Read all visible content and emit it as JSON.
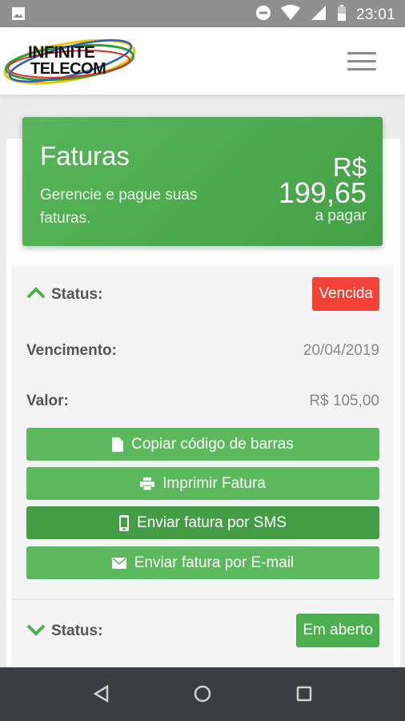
{
  "status_bar": {
    "time": "23:01",
    "icons": [
      "image-icon",
      "do-not-disturb-icon",
      "wifi-icon",
      "signal-icon",
      "battery-icon"
    ]
  },
  "header": {
    "logo_line1": "INFINITE",
    "logo_line2": "TELECOM",
    "menu_icon": "hamburger-icon"
  },
  "hero": {
    "title": "Faturas",
    "subtitle": "Gerencie e pague suas faturas.",
    "amount_currency": "R$",
    "amount_value": "199,65",
    "amount_label": "a pagar"
  },
  "invoice": {
    "status_label": "Status:",
    "status_value": "Vencida",
    "due_label": "Vencimento:",
    "due_value": "20/04/2019",
    "value_label": "Valor:",
    "value_value": "R$ 105,00",
    "actions": {
      "copy": "Copiar código de barras",
      "print": "Imprimir Fatura",
      "sms": "Enviar fatura por SMS",
      "email": "Enviar fatura por E-mail"
    }
  },
  "invoice2": {
    "status_label": "Status:",
    "status_value": "Em aberto"
  },
  "colors": {
    "primary_green": "#4caf50",
    "overdue_red": "#f44336",
    "active_green": "#449d44"
  }
}
